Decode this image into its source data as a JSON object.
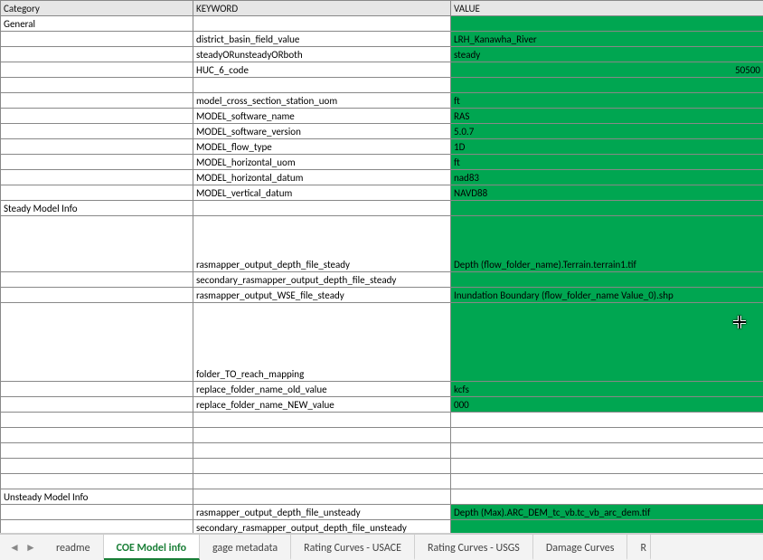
{
  "columns": {
    "category": "Category",
    "keyword": "KEYWORD",
    "value": "VALUE"
  },
  "rows": [
    {
      "cat": "General",
      "key": "",
      "val": "",
      "green": true
    },
    {
      "cat": "",
      "key": "district_basin_field_value",
      "val": "LRH_Kanawha_River",
      "green": true
    },
    {
      "cat": "",
      "key": "steadyORunsteadyORboth",
      "val": "steady",
      "green": true
    },
    {
      "cat": "",
      "key": "HUC_6_code",
      "val": "50500",
      "green": true,
      "right": true
    },
    {
      "cat": "",
      "key": "",
      "val": "",
      "green": true
    },
    {
      "cat": "",
      "key": "model_cross_section_station_uom",
      "val": "ft",
      "green": true
    },
    {
      "cat": "",
      "key": "MODEL_software_name",
      "val": "RAS",
      "green": true
    },
    {
      "cat": "",
      "key": "MODEL_software_version",
      "val": "5.0.7",
      "green": true
    },
    {
      "cat": "",
      "key": "MODEL_flow_type",
      "val": "1D",
      "green": true
    },
    {
      "cat": "",
      "key": "MODEL_horizontal_uom",
      "val": "ft",
      "green": true
    },
    {
      "cat": "",
      "key": "MODEL_horizontal_datum",
      "val": "nad83",
      "green": true
    },
    {
      "cat": "",
      "key": "MODEL_vertical_datum",
      "val": "NAVD88",
      "green": true
    },
    {
      "cat": "Steady Model Info",
      "key": "",
      "val": "",
      "green": true
    },
    {
      "cat": "",
      "key": "rasmapper_output_depth_file_steady",
      "val": "Depth (flow_folder_name).Terrain.terrain1.tif",
      "green": true,
      "tall": 3
    },
    {
      "cat": "",
      "key": "secondary_rasmapper_output_depth_file_steady",
      "val": "",
      "green": true
    },
    {
      "cat": "",
      "key": "rasmapper_output_WSE_file_steady",
      "val": "Inundation Boundary (flow_folder_name Value_0).shp",
      "green": true
    },
    {
      "cat": "",
      "key": "folder_TO_reach_mapping",
      "val": "",
      "green": true,
      "tall": 5,
      "comment": true
    },
    {
      "cat": "",
      "key": "replace_folder_name_old_value",
      "val": "kcfs",
      "green": true
    },
    {
      "cat": "",
      "key": "replace_folder_name_NEW_value",
      "val": "000",
      "green": true
    },
    {
      "cat": "",
      "key": "",
      "val": ""
    },
    {
      "cat": "",
      "key": "",
      "val": ""
    },
    {
      "cat": "",
      "key": "",
      "val": ""
    },
    {
      "cat": "",
      "key": "",
      "val": ""
    },
    {
      "cat": "",
      "key": "",
      "val": ""
    },
    {
      "cat": "Unsteady Model Info",
      "key": "",
      "val": ""
    },
    {
      "cat": "",
      "key": "rasmapper_output_depth_file_unsteady",
      "val": "Depth (Max).ARC_DEM_tc_vb.tc_vb_arc_dem.tif",
      "green": true
    },
    {
      "cat": "",
      "key": "secondary_rasmapper_output_depth_file_unsteady",
      "val": "",
      "green": true
    }
  ],
  "tabs": {
    "items": [
      "readme",
      "COE Model info",
      "gage metadata",
      "Rating Curves - USACE",
      "Rating Curves - USGS",
      "Damage Curves",
      "R"
    ],
    "active": 1
  }
}
